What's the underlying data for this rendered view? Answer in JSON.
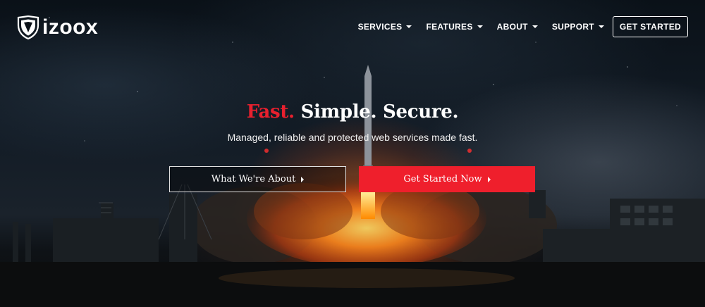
{
  "brand": {
    "name": "izoox",
    "logo_icon": "shield-logo-icon"
  },
  "nav": {
    "items": [
      {
        "label": "SERVICES",
        "icon": "chevron-down-icon"
      },
      {
        "label": "FEATURES",
        "icon": "chevron-down-icon"
      },
      {
        "label": "ABOUT",
        "icon": "chevron-down-icon"
      },
      {
        "label": "SUPPORT",
        "icon": "chevron-down-icon"
      }
    ],
    "cta_label": "GET STARTED"
  },
  "hero": {
    "title_accent": "Fast.",
    "title_rest": "Simple. Secure.",
    "subtitle": "Managed, reliable and protected web services made fast.",
    "primary_button_label": "What We're About",
    "secondary_button_label": "Get Started Now",
    "button_icon": "caret-right-icon"
  },
  "colors": {
    "accent": "#ef1f2c",
    "text": "#ffffff",
    "background": "#0b1118"
  }
}
